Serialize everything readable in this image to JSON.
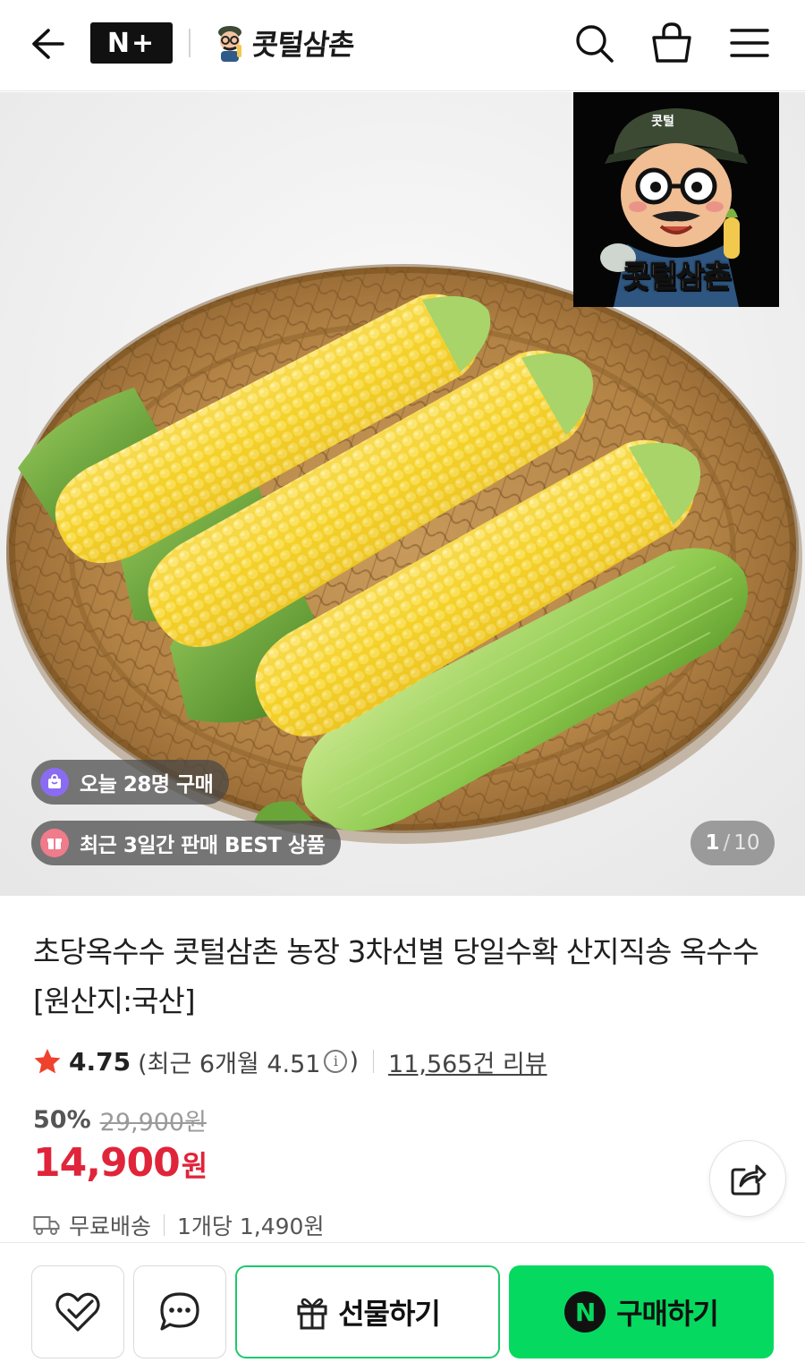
{
  "header": {
    "badge_label": "N+",
    "store_name": "콧털삼촌"
  },
  "hero": {
    "logo_text": "콧털삼촌",
    "logo_hat_text": "콧털",
    "badges": [
      {
        "text": "오늘 28명 구매"
      },
      {
        "text": "최근 3일간 판매 BEST 상품"
      }
    ],
    "counter": {
      "current": "1",
      "separator": "/",
      "total": "10"
    }
  },
  "product": {
    "title": "초당옥수수 콧털삼촌 농장 3차선별 당일수확 산지직송 옥수수 [원산지:국산]",
    "rating": "4.75",
    "recent_prefix": "(최근 6개월 4.51",
    "recent_suffix": ")",
    "info_symbol": "i",
    "review_count": "11,565건 리뷰",
    "discount_rate": "50%",
    "original_price": "29,900원",
    "price": "14,900",
    "currency": "원",
    "shipping": "무료배송",
    "unit_price": "1개당 1,490원"
  },
  "bottom_bar": {
    "gift_label": "선물하기",
    "buy_label": "구매하기",
    "buy_badge": "N"
  },
  "colors": {
    "price_red": "#e0243a",
    "buy_green": "#06d95f",
    "gift_border": "#1ec86a",
    "badge_purple": "#8a6cf2",
    "badge_pink": "#f07b8b"
  }
}
